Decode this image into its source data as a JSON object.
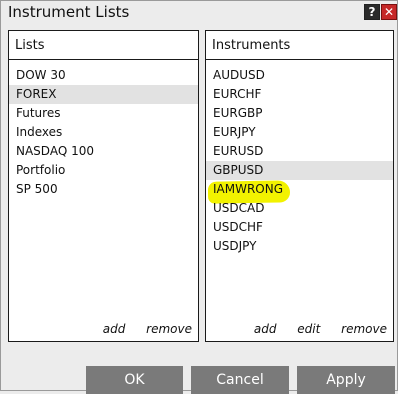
{
  "window": {
    "title": "Instrument Lists",
    "help_label": "?",
    "close_label": "✕"
  },
  "lists_panel": {
    "header": "Lists",
    "items": [
      "DOW 30",
      "FOREX",
      "Futures",
      "Indexes",
      "NASDAQ 100",
      "Portfolio",
      "SP 500"
    ],
    "selected": "FOREX",
    "actions": {
      "add": "add",
      "remove": "remove"
    }
  },
  "instruments_panel": {
    "header": "Instruments",
    "items": [
      "AUDUSD",
      "EURCHF",
      "EURGBP",
      "EURJPY",
      "EURUSD",
      "GBPUSD",
      "IAMWRONG",
      "USDCAD",
      "USDCHF",
      "USDJPY"
    ],
    "selected": "GBPUSD",
    "highlighted": "IAMWRONG",
    "actions": {
      "add": "add",
      "edit": "edit",
      "remove": "remove"
    }
  },
  "buttons": {
    "ok": "OK",
    "cancel": "Cancel",
    "apply": "Apply"
  },
  "colors": {
    "button_bg": "#7a7a7a",
    "close_bg": "#c62828",
    "highlight": "#f2f200",
    "selected_row": "#e2e2e2"
  }
}
